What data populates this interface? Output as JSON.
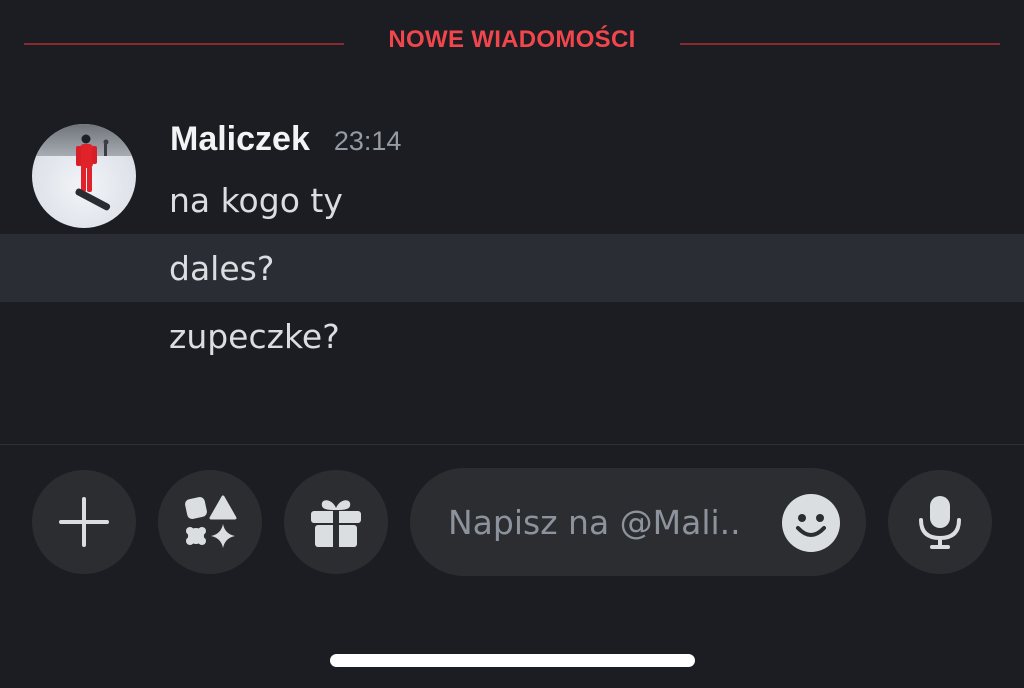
{
  "divider": {
    "label": "NOWE WIADOMOŚCI",
    "color": "#f0464c"
  },
  "message_group": {
    "username": "Maliczek",
    "timestamp": "23:14",
    "avatar": "snowboarder-photo",
    "messages": [
      "na kogo ty",
      "dales?",
      "zupeczke?"
    ],
    "highlighted_index": 1
  },
  "composer": {
    "placeholder": "Napisz na @Mali..",
    "icons": {
      "add": "plus-icon",
      "apps": "apps-icon",
      "gift": "gift-icon",
      "emoji": "emoji-icon",
      "voice": "microphone-icon"
    }
  },
  "colors": {
    "background": "#1c1d22",
    "highlight_row": "#2b2d35",
    "button_bg": "#2b2d31"
  }
}
